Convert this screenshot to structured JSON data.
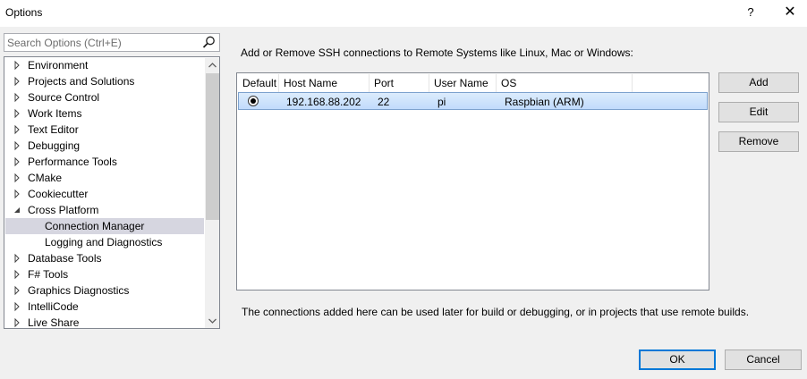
{
  "window": {
    "title": "Options",
    "help_label": "?",
    "close_label": "✕"
  },
  "search": {
    "placeholder": "Search Options (Ctrl+E)",
    "value": ""
  },
  "tree": {
    "items": [
      {
        "label": "Environment",
        "expander": "collapsed",
        "level": 0
      },
      {
        "label": "Projects and Solutions",
        "expander": "collapsed",
        "level": 0
      },
      {
        "label": "Source Control",
        "expander": "collapsed",
        "level": 0
      },
      {
        "label": "Work Items",
        "expander": "collapsed",
        "level": 0
      },
      {
        "label": "Text Editor",
        "expander": "collapsed",
        "level": 0
      },
      {
        "label": "Debugging",
        "expander": "collapsed",
        "level": 0
      },
      {
        "label": "Performance Tools",
        "expander": "collapsed",
        "level": 0
      },
      {
        "label": "CMake",
        "expander": "collapsed",
        "level": 0
      },
      {
        "label": "Cookiecutter",
        "expander": "collapsed",
        "level": 0
      },
      {
        "label": "Cross Platform",
        "expander": "expanded",
        "level": 0
      },
      {
        "label": "Connection Manager",
        "expander": "none",
        "level": 1,
        "selected": true
      },
      {
        "label": "Logging and Diagnostics",
        "expander": "none",
        "level": 1
      },
      {
        "label": "Database Tools",
        "expander": "collapsed",
        "level": 0
      },
      {
        "label": "F# Tools",
        "expander": "collapsed",
        "level": 0
      },
      {
        "label": "Graphics Diagnostics",
        "expander": "collapsed",
        "level": 0
      },
      {
        "label": "IntelliCode",
        "expander": "collapsed",
        "level": 0
      },
      {
        "label": "Live Share",
        "expander": "collapsed",
        "level": 0
      }
    ]
  },
  "main": {
    "description": "Add or Remove SSH connections to Remote Systems like Linux, Mac or Windows:",
    "columns": [
      "Default",
      "Host Name",
      "Port",
      "User Name",
      "OS"
    ],
    "rows": [
      {
        "default": true,
        "host": "192.168.88.202",
        "port": "22",
        "user": "pi",
        "os": "Raspbian (ARM)"
      }
    ],
    "footer": "The connections added here can be used later for build or debugging, or in projects that use remote builds."
  },
  "actions": {
    "add": "Add",
    "edit": "Edit",
    "remove": "Remove"
  },
  "dialog": {
    "ok": "OK",
    "cancel": "Cancel"
  }
}
